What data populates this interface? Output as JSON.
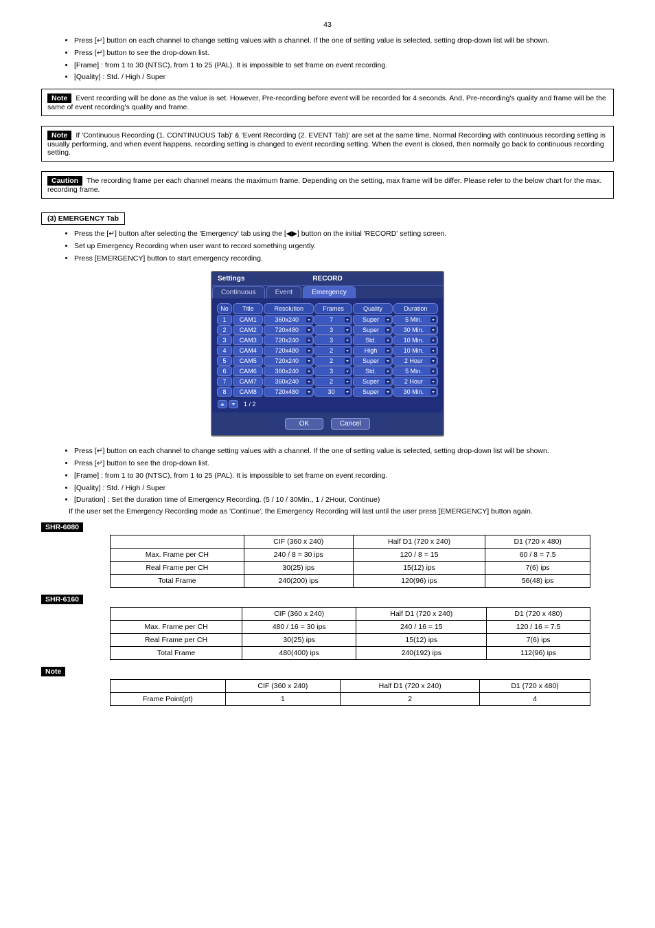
{
  "page_number": "43",
  "instructions_top": [
    {
      "pre": "Press [",
      "sym": "↵",
      "post": "] button on each channel to change setting values with a channel. If the one of setting value is selected, setting drop-down list will be shown."
    },
    {
      "pre": "Press [",
      "sym": "↵",
      "post": "] button to see the drop-down list."
    },
    {
      "pre": "",
      "sym": "",
      "post": "[Frame] : from 1 to 30 (NTSC), from 1 to 25 (PAL). It is impossible to set frame on event recording."
    },
    {
      "pre": "",
      "sym": "",
      "post": "[Quality] : Std. / High / Super"
    }
  ],
  "notes": [
    {
      "chip": "Note",
      "text": "Event recording will be done as the value is set. However, Pre-recording before event will be recorded for 4 seconds. And, Pre-recording's quality and frame will be the same of event recording's quality and frame."
    },
    {
      "chip": "Note",
      "text": "If 'Continuous Recording (1. CONTINUOUS Tab)' & 'Event Recording (2. EVENT Tab)' are set at the same time, Normal Recording with continuous recording setting is usually performing, and when event happens, recording setting is changed to event recording setting. When the event is closed, then normally go back to continuous recording setting."
    },
    {
      "chip": "Caution",
      "text": "The recording frame per each channel means the maximum frame. Depending on the setting, max frame will be differ. Please refer to the below chart for the max. recording frame."
    }
  ],
  "emergency_label": "(3) EMERGENCY Tab",
  "emergency_list": [
    {
      "pre": "Press the [",
      "sym": "↵",
      "post": "] button after selecting the 'Emergency' tab using the [◀▶] button on the initial 'RECORD' setting screen."
    },
    {
      "pre": "",
      "sym": "",
      "post": "Set up Emergency Recording when user want to record something urgently."
    },
    {
      "pre": "",
      "sym": "",
      "post": "Press [EMERGENCY] button to start emergency recording."
    }
  ],
  "screenshot": {
    "title_left": "Settings",
    "title_mid": "RECORD",
    "tabs": [
      "Continuous",
      "Event",
      "Emergency"
    ],
    "active_tab": 2,
    "columns": [
      "No",
      "Title",
      "Resolution",
      "Frames",
      "Quality",
      "Duration"
    ],
    "rows": [
      {
        "no": "1",
        "title": "CAM1",
        "res": "360x240",
        "frames": "7",
        "quality": "Super",
        "duration": "5 Min."
      },
      {
        "no": "2",
        "title": "CAM2",
        "res": "720x480",
        "frames": "3",
        "quality": "Super",
        "duration": "30 Min."
      },
      {
        "no": "3",
        "title": "CAM3",
        "res": "720x240",
        "frames": "3",
        "quality": "Std.",
        "duration": "10 Min."
      },
      {
        "no": "4",
        "title": "CAM4",
        "res": "720x480",
        "frames": "2",
        "quality": "High",
        "duration": "10 Min."
      },
      {
        "no": "5",
        "title": "CAM5",
        "res": "720x240",
        "frames": "2",
        "quality": "Super",
        "duration": "2 Hour"
      },
      {
        "no": "6",
        "title": "CAM6",
        "res": "360x240",
        "frames": "3",
        "quality": "Std.",
        "duration": "5 Min."
      },
      {
        "no": "7",
        "title": "CAM7",
        "res": "360x240",
        "frames": "2",
        "quality": "Super",
        "duration": "2 Hour"
      },
      {
        "no": "8",
        "title": "CAM8",
        "res": "720x480",
        "frames": "30",
        "quality": "Super",
        "duration": "30 Min."
      }
    ],
    "pager": "1 / 2",
    "ok": "OK",
    "cancel": "Cancel"
  },
  "instructions_bottom": [
    {
      "pre": "Press [",
      "sym": "↵",
      "post": "] button on each channel to change setting values with a channel. If the one of setting value is selected, setting drop-down list will be shown."
    },
    {
      "pre": "Press [",
      "sym": "↵",
      "post": "] button to see the drop-down list."
    },
    {
      "pre": "",
      "sym": "",
      "post": "[Frame] : from 1 to 30 (NTSC), from 1 to 25 (PAL). It is impossible to set frame on event recording."
    },
    {
      "pre": "",
      "sym": "",
      "post": "[Quality] : Std. / High / Super"
    },
    {
      "pre": "",
      "sym": "",
      "post": "[Duration] : Set the duration time of Emergency Recording. (5 / 10 / 30Min., 1 / 2Hour, Continue)"
    }
  ],
  "indent_note": "If the user set the Emergency Recording mode as 'Continue', the Emergency Recording will last until the user press [EMERGENCY] button again.",
  "chart_data": [
    {
      "chip": "SHR-6080",
      "headers": [
        "",
        "CIF (360 x 240)",
        "Half D1 (720 x 240)",
        "D1 (720 x 480)"
      ],
      "rows": [
        [
          "Max. Frame per CH",
          "240 / 8 = 30 ips",
          "120 / 8 = 15",
          "60 / 8 = 7.5"
        ],
        [
          "Real Frame per CH",
          "30(25) ips",
          "15(12) ips",
          "7(6) ips"
        ],
        [
          "Total Frame",
          "240(200) ips",
          "120(96) ips",
          "56(48) ips"
        ]
      ]
    },
    {
      "chip": "SHR-6160",
      "headers": [
        "",
        "CIF (360 x 240)",
        "Half D1 (720 x 240)",
        "D1 (720 x 480)"
      ],
      "rows": [
        [
          "Max. Frame per CH",
          "480 / 16 = 30 ips",
          "240 / 16 = 15",
          "120 / 16 = 7.5"
        ],
        [
          "Real Frame per CH",
          "30(25) ips",
          "15(12) ips",
          "7(6) ips"
        ],
        [
          "Total Frame",
          "480(400) ips",
          "240(192) ips",
          "112(96) ips"
        ]
      ]
    },
    {
      "chip": "Note",
      "headers": [
        "",
        "CIF (360 x 240)",
        "Half D1 (720 x 240)",
        "D1 (720 x 480)"
      ],
      "rows": [
        [
          "Frame Point(pt)",
          "1",
          "2",
          "4"
        ]
      ]
    }
  ]
}
